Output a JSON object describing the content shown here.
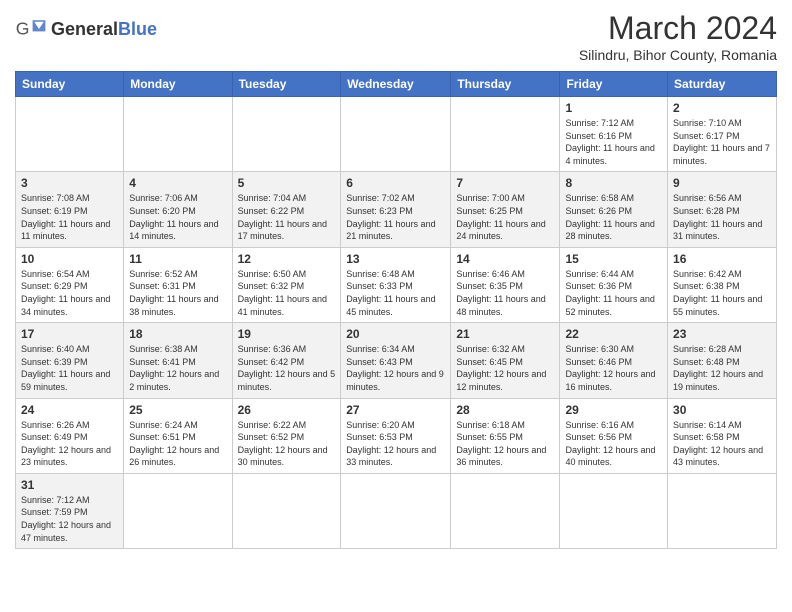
{
  "logo": {
    "text_general": "General",
    "text_blue": "Blue"
  },
  "title": {
    "month_year": "March 2024",
    "location": "Silindru, Bihor County, Romania"
  },
  "weekdays": [
    "Sunday",
    "Monday",
    "Tuesday",
    "Wednesday",
    "Thursday",
    "Friday",
    "Saturday"
  ],
  "weeks": [
    [
      {
        "day": "",
        "info": ""
      },
      {
        "day": "",
        "info": ""
      },
      {
        "day": "",
        "info": ""
      },
      {
        "day": "",
        "info": ""
      },
      {
        "day": "",
        "info": ""
      },
      {
        "day": "1",
        "info": "Sunrise: 7:12 AM\nSunset: 6:16 PM\nDaylight: 11 hours and 4 minutes."
      },
      {
        "day": "2",
        "info": "Sunrise: 7:10 AM\nSunset: 6:17 PM\nDaylight: 11 hours and 7 minutes."
      }
    ],
    [
      {
        "day": "3",
        "info": "Sunrise: 7:08 AM\nSunset: 6:19 PM\nDaylight: 11 hours and 11 minutes."
      },
      {
        "day": "4",
        "info": "Sunrise: 7:06 AM\nSunset: 6:20 PM\nDaylight: 11 hours and 14 minutes."
      },
      {
        "day": "5",
        "info": "Sunrise: 7:04 AM\nSunset: 6:22 PM\nDaylight: 11 hours and 17 minutes."
      },
      {
        "day": "6",
        "info": "Sunrise: 7:02 AM\nSunset: 6:23 PM\nDaylight: 11 hours and 21 minutes."
      },
      {
        "day": "7",
        "info": "Sunrise: 7:00 AM\nSunset: 6:25 PM\nDaylight: 11 hours and 24 minutes."
      },
      {
        "day": "8",
        "info": "Sunrise: 6:58 AM\nSunset: 6:26 PM\nDaylight: 11 hours and 28 minutes."
      },
      {
        "day": "9",
        "info": "Sunrise: 6:56 AM\nSunset: 6:28 PM\nDaylight: 11 hours and 31 minutes."
      }
    ],
    [
      {
        "day": "10",
        "info": "Sunrise: 6:54 AM\nSunset: 6:29 PM\nDaylight: 11 hours and 34 minutes."
      },
      {
        "day": "11",
        "info": "Sunrise: 6:52 AM\nSunset: 6:31 PM\nDaylight: 11 hours and 38 minutes."
      },
      {
        "day": "12",
        "info": "Sunrise: 6:50 AM\nSunset: 6:32 PM\nDaylight: 11 hours and 41 minutes."
      },
      {
        "day": "13",
        "info": "Sunrise: 6:48 AM\nSunset: 6:33 PM\nDaylight: 11 hours and 45 minutes."
      },
      {
        "day": "14",
        "info": "Sunrise: 6:46 AM\nSunset: 6:35 PM\nDaylight: 11 hours and 48 minutes."
      },
      {
        "day": "15",
        "info": "Sunrise: 6:44 AM\nSunset: 6:36 PM\nDaylight: 11 hours and 52 minutes."
      },
      {
        "day": "16",
        "info": "Sunrise: 6:42 AM\nSunset: 6:38 PM\nDaylight: 11 hours and 55 minutes."
      }
    ],
    [
      {
        "day": "17",
        "info": "Sunrise: 6:40 AM\nSunset: 6:39 PM\nDaylight: 11 hours and 59 minutes."
      },
      {
        "day": "18",
        "info": "Sunrise: 6:38 AM\nSunset: 6:41 PM\nDaylight: 12 hours and 2 minutes."
      },
      {
        "day": "19",
        "info": "Sunrise: 6:36 AM\nSunset: 6:42 PM\nDaylight: 12 hours and 5 minutes."
      },
      {
        "day": "20",
        "info": "Sunrise: 6:34 AM\nSunset: 6:43 PM\nDaylight: 12 hours and 9 minutes."
      },
      {
        "day": "21",
        "info": "Sunrise: 6:32 AM\nSunset: 6:45 PM\nDaylight: 12 hours and 12 minutes."
      },
      {
        "day": "22",
        "info": "Sunrise: 6:30 AM\nSunset: 6:46 PM\nDaylight: 12 hours and 16 minutes."
      },
      {
        "day": "23",
        "info": "Sunrise: 6:28 AM\nSunset: 6:48 PM\nDaylight: 12 hours and 19 minutes."
      }
    ],
    [
      {
        "day": "24",
        "info": "Sunrise: 6:26 AM\nSunset: 6:49 PM\nDaylight: 12 hours and 23 minutes."
      },
      {
        "day": "25",
        "info": "Sunrise: 6:24 AM\nSunset: 6:51 PM\nDaylight: 12 hours and 26 minutes."
      },
      {
        "day": "26",
        "info": "Sunrise: 6:22 AM\nSunset: 6:52 PM\nDaylight: 12 hours and 30 minutes."
      },
      {
        "day": "27",
        "info": "Sunrise: 6:20 AM\nSunset: 6:53 PM\nDaylight: 12 hours and 33 minutes."
      },
      {
        "day": "28",
        "info": "Sunrise: 6:18 AM\nSunset: 6:55 PM\nDaylight: 12 hours and 36 minutes."
      },
      {
        "day": "29",
        "info": "Sunrise: 6:16 AM\nSunset: 6:56 PM\nDaylight: 12 hours and 40 minutes."
      },
      {
        "day": "30",
        "info": "Sunrise: 6:14 AM\nSunset: 6:58 PM\nDaylight: 12 hours and 43 minutes."
      }
    ],
    [
      {
        "day": "31",
        "info": "Sunrise: 7:12 AM\nSunset: 7:59 PM\nDaylight: 12 hours and 47 minutes."
      },
      {
        "day": "",
        "info": ""
      },
      {
        "day": "",
        "info": ""
      },
      {
        "day": "",
        "info": ""
      },
      {
        "day": "",
        "info": ""
      },
      {
        "day": "",
        "info": ""
      },
      {
        "day": "",
        "info": ""
      }
    ]
  ]
}
